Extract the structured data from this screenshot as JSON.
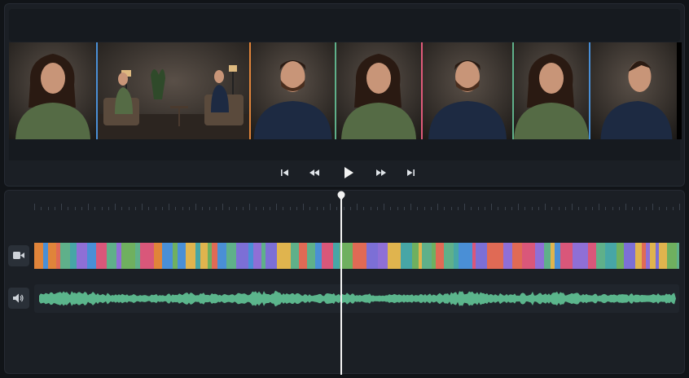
{
  "app": {
    "name": "video-editor"
  },
  "viewer": {
    "thumbnails": [
      {
        "name": "woman-closeup-1",
        "subject": "woman",
        "accent": "#e0a44e"
      },
      {
        "name": "interview-wide",
        "subject": "wide",
        "accent": "#4a8fd6"
      },
      {
        "name": "man-closeup-1",
        "subject": "man",
        "accent": "#e0843a"
      },
      {
        "name": "woman-closeup-2",
        "subject": "woman",
        "accent": "#5fb08a"
      },
      {
        "name": "man-closeup-2",
        "subject": "man",
        "accent": "#e05a7a"
      },
      {
        "name": "woman-closeup-3",
        "subject": "woman",
        "accent": "#5fb08a"
      },
      {
        "name": "man-profile",
        "subject": "man-profile",
        "accent": "#4a8fd6"
      }
    ]
  },
  "transport": {
    "buttons": [
      "skip-back",
      "rewind",
      "play",
      "fast-forward",
      "skip-forward"
    ]
  },
  "timeline": {
    "video_track_icon": "video-camera-icon",
    "audio_track_icon": "speaker-icon",
    "segment_colors": [
      "#8f6fd6",
      "#d9577a",
      "#4a8fd6",
      "#e0b44e",
      "#5fb08a",
      "#e0843a",
      "#7c6fd6",
      "#47a6a6",
      "#e06a55",
      "#6fb05f"
    ],
    "waveform_color": "#5bb58c",
    "playhead_color": "#f2f2f2"
  }
}
